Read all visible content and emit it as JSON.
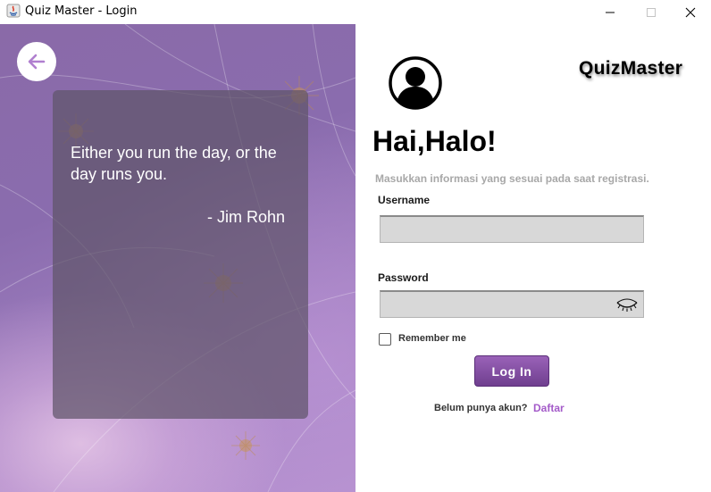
{
  "window": {
    "title": "Quiz Master - Login",
    "controls": {
      "minimize_icon": "minimize-icon",
      "maximize_icon": "maximize-icon",
      "close_icon": "close-icon"
    }
  },
  "left_panel": {
    "back_icon": "arrow-left-icon",
    "quote": {
      "text": "Either you run the day, or the day runs you.",
      "author": "- Jim Rohn"
    }
  },
  "right_panel": {
    "brand": "QuizMaster",
    "avatar_icon": "user-avatar-icon",
    "greeting": "Hai,Halo!",
    "subtitle": "Masukkan informasi yang sesuai pada saat registrasi.",
    "username": {
      "label": "Username",
      "value": "",
      "placeholder": ""
    },
    "password": {
      "label": "Password",
      "value": "",
      "placeholder": "",
      "toggle_icon": "eye-closed-icon"
    },
    "remember": {
      "label": "Remember me",
      "checked": false
    },
    "login_button": "Log In",
    "signup": {
      "prompt": "Belum punya akun?",
      "link": "Daftar"
    }
  },
  "colors": {
    "accent": "#a45bc9",
    "button": "#7f4aa0",
    "panel": "#8a6cae",
    "field": "#d8d8d8"
  }
}
